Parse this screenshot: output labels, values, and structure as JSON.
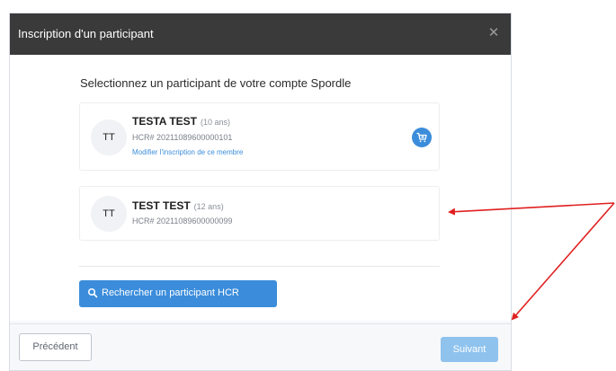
{
  "modal": {
    "title": "Inscription d'un participant",
    "close_glyph": "✕",
    "heading": "Selectionnez un participant de votre compte Spordle"
  },
  "participants": [
    {
      "initials": "TT",
      "name": "TESTA TEST",
      "age": "(10 ans)",
      "hcr": "HCR# 20211089600000101",
      "link": "Modifier l'inscription de ce membre",
      "has_cart": true
    },
    {
      "initials": "TT",
      "name": "TEST TEST",
      "age": "(12 ans)",
      "hcr": "HCR# 20211089600000099",
      "has_cart": false
    }
  ],
  "search_button": {
    "label": "Rechercher un participant HCR",
    "icon": "search-icon"
  },
  "footer": {
    "previous_label": "Précédent",
    "next_label": "Suivant"
  },
  "colors": {
    "header_bg": "#3a3a3a",
    "accent": "#3b8ddb",
    "next_disabled": "#8fc3ee",
    "annotation_arrow": "#e02020"
  }
}
